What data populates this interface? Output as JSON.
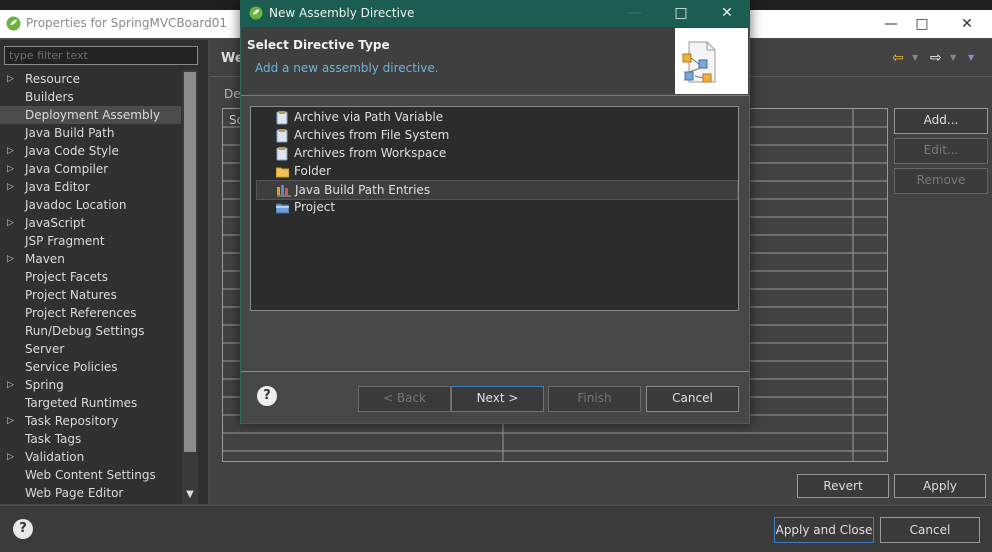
{
  "parent": {
    "title": "Properties for SpringMVCBoard01",
    "filter_placeholder": "type filter text",
    "tree": [
      {
        "label": "Resource",
        "expandable": true
      },
      {
        "label": "Builders",
        "expandable": false
      },
      {
        "label": "Deployment Assembly",
        "expandable": false,
        "selected": true
      },
      {
        "label": "Java Build Path",
        "expandable": false
      },
      {
        "label": "Java Code Style",
        "expandable": true
      },
      {
        "label": "Java Compiler",
        "expandable": true
      },
      {
        "label": "Java Editor",
        "expandable": true
      },
      {
        "label": "Javadoc Location",
        "expandable": false
      },
      {
        "label": "JavaScript",
        "expandable": true
      },
      {
        "label": "JSP Fragment",
        "expandable": false
      },
      {
        "label": "Maven",
        "expandable": true
      },
      {
        "label": "Project Facets",
        "expandable": false
      },
      {
        "label": "Project Natures",
        "expandable": false
      },
      {
        "label": "Project References",
        "expandable": false
      },
      {
        "label": "Run/Debug Settings",
        "expandable": false
      },
      {
        "label": "Server",
        "expandable": false
      },
      {
        "label": "Service Policies",
        "expandable": false
      },
      {
        "label": "Spring",
        "expandable": true
      },
      {
        "label": "Targeted Runtimes",
        "expandable": false
      },
      {
        "label": "Task Repository",
        "expandable": true
      },
      {
        "label": "Task Tags",
        "expandable": false
      },
      {
        "label": "Validation",
        "expandable": true
      },
      {
        "label": "Web Content Settings",
        "expandable": false
      },
      {
        "label": "Web Page Editor",
        "expandable": false
      }
    ],
    "page_title": "We",
    "tab_text": "De",
    "grid_header": "So",
    "side_buttons": {
      "add": "Add...",
      "edit": "Edit...",
      "remove": "Remove"
    },
    "revert": "Revert",
    "apply": "Apply",
    "apply_and_close": "Apply and Close",
    "cancel": "Cancel"
  },
  "dialog": {
    "title": "New Assembly Directive",
    "heading": "Select Directive Type",
    "subheading": "Add a new assembly directive.",
    "items": [
      {
        "label": "Archive via Path Variable",
        "icon": "jar-icon"
      },
      {
        "label": "Archives from File System",
        "icon": "jar-icon"
      },
      {
        "label": "Archives from Workspace",
        "icon": "jar-icon"
      },
      {
        "label": "Folder",
        "icon": "folder-icon"
      },
      {
        "label": "Java Build Path Entries",
        "icon": "library-icon",
        "selected": true
      },
      {
        "label": "Project",
        "icon": "project-folder-icon"
      }
    ],
    "buttons": {
      "back": "< Back",
      "next": "Next >",
      "finish": "Finish",
      "cancel": "Cancel"
    }
  },
  "colors": {
    "dialog_titlebar": "#1b5d50",
    "subheading": "#6fb4d9",
    "focus_border": "#3d7ec2"
  }
}
